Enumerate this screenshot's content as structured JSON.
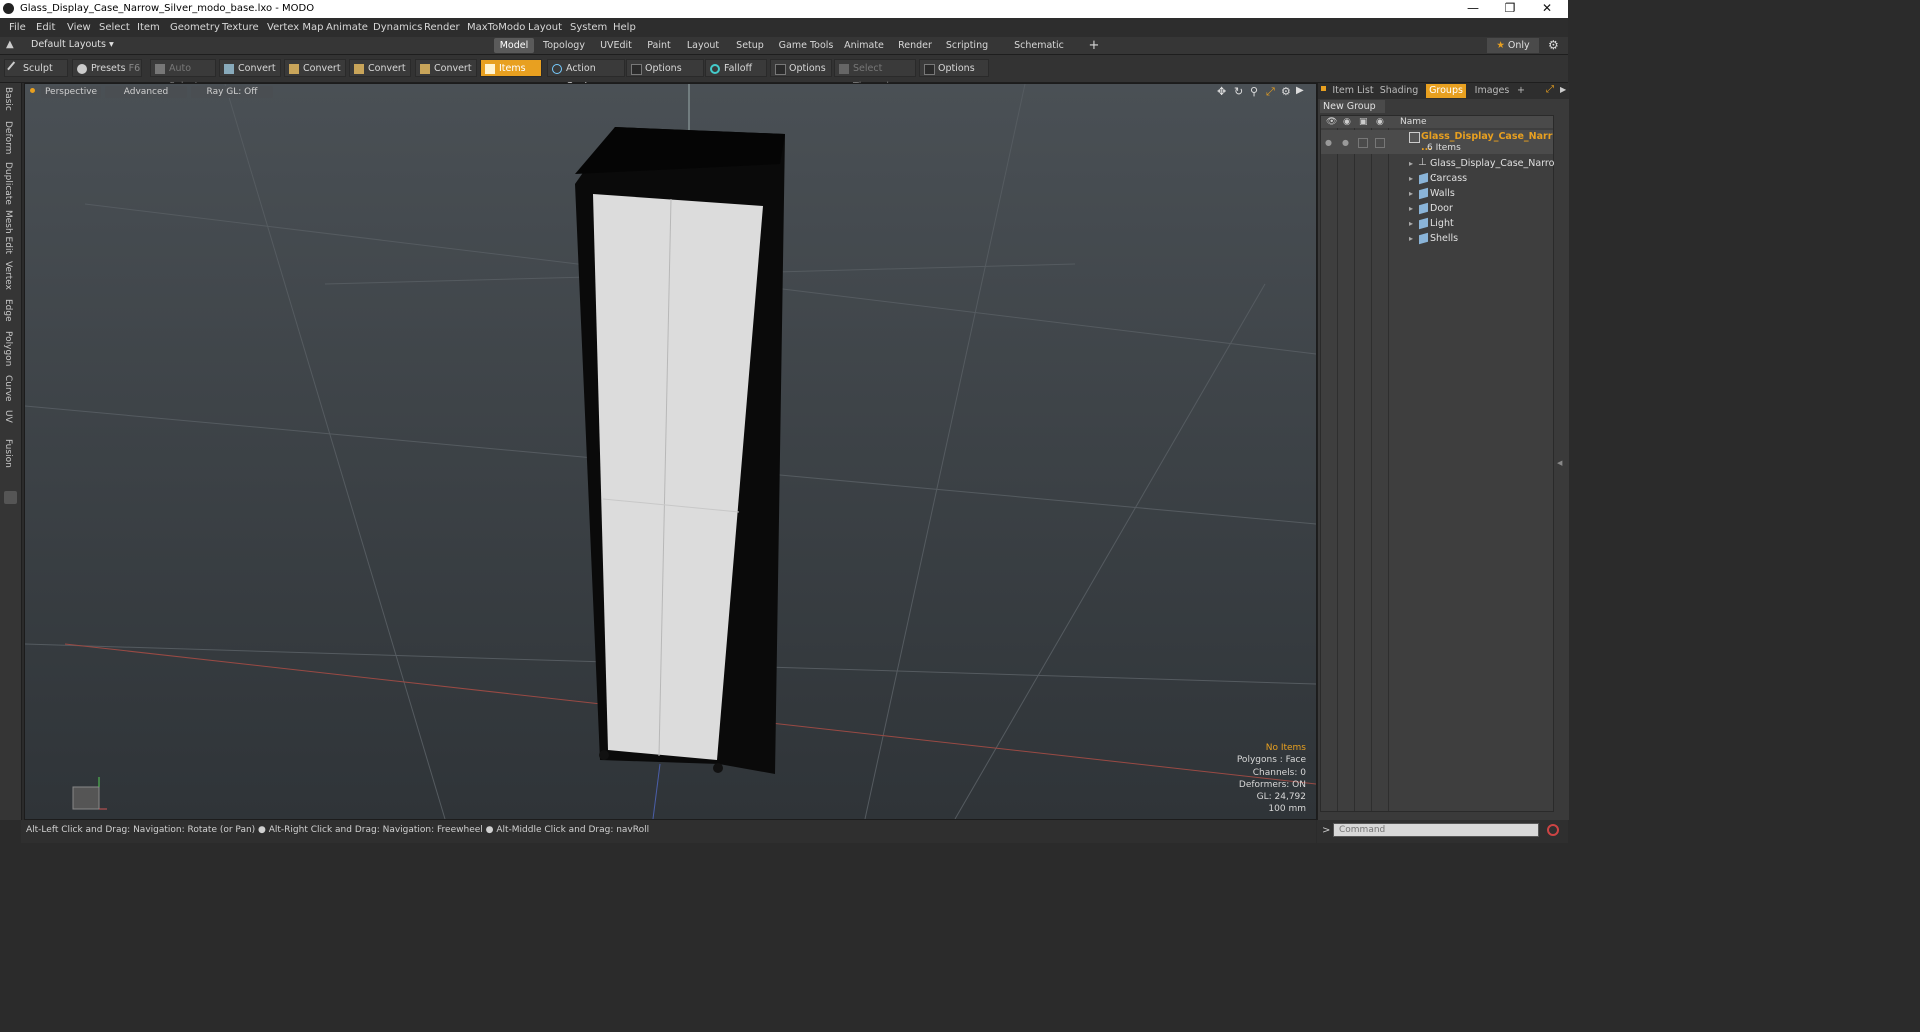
{
  "window": {
    "title": "Glass_Display_Case_Narrow_Silver_modo_base.lxo - MODO"
  },
  "menu": [
    "File",
    "Edit",
    "View",
    "Select",
    "Item",
    "Geometry",
    "Texture",
    "Vertex Map",
    "Animate",
    "Dynamics",
    "Render",
    "MaxToModo",
    "Layout",
    "System",
    "Help"
  ],
  "layoutbar": {
    "layout_select": "Default Layouts",
    "tabs": [
      "Model",
      "Topology",
      "UVEdit",
      "Paint",
      "Layout",
      "Setup",
      "Game Tools",
      "Animate",
      "Render",
      "Scripting",
      "Schematic Fusion"
    ],
    "active_tab": "Model",
    "plus": "+",
    "only": "Only"
  },
  "toolbar": {
    "sculpt": "Sculpt",
    "presets": "Presets",
    "presets_key": "F6",
    "auto_select": "Auto Select",
    "convert1": "Convert",
    "convert2": "Convert",
    "convert3": "Convert",
    "convert4": "Convert",
    "items": "Items",
    "action_center": "Action Center",
    "options1": "Options",
    "falloff": "Falloff",
    "options2": "Options",
    "select_through": "Select Through",
    "options3": "Options"
  },
  "left_tabs": [
    "Basic",
    "Deform",
    "Duplicate",
    "Mesh Edit",
    "Vertex",
    "Edge",
    "Polygon",
    "Curve",
    "UV",
    "Fusion"
  ],
  "viewport": {
    "view_mode": "Perspective",
    "advanced": "Advanced",
    "raygl": "Ray GL: Off",
    "stats": {
      "no_items": "No Items",
      "polygons": "Polygons : Face",
      "channels": "Channels: 0",
      "deformers": "Deformers: ON",
      "gl": "GL: 24,792",
      "scale": "100 mm"
    },
    "colors": {
      "background": "#3b4044",
      "highlight": "#e8a020"
    }
  },
  "statusbar": {
    "hint": "Alt-Left Click and Drag: Navigation: Rotate (or Pan) ● Alt-Right Click and Drag: Navigation: Freewheel ● Alt-Middle Click and Drag: navRoll"
  },
  "rightpanel": {
    "tabs": [
      "Item List",
      "Shading",
      "Groups",
      "Images"
    ],
    "active_tab": "Groups",
    "plus": "+",
    "new_group": "New Group",
    "column_name": "Name",
    "group": {
      "name": "Glass_Display_Case_Narr ...",
      "count": "6 Items"
    },
    "items": [
      "Glass_Display_Case_Narro ...",
      "Carcass",
      "Walls",
      "Door",
      "Light",
      "Shells"
    ]
  },
  "command": {
    "placeholder": "Command",
    "prompt": ">"
  }
}
